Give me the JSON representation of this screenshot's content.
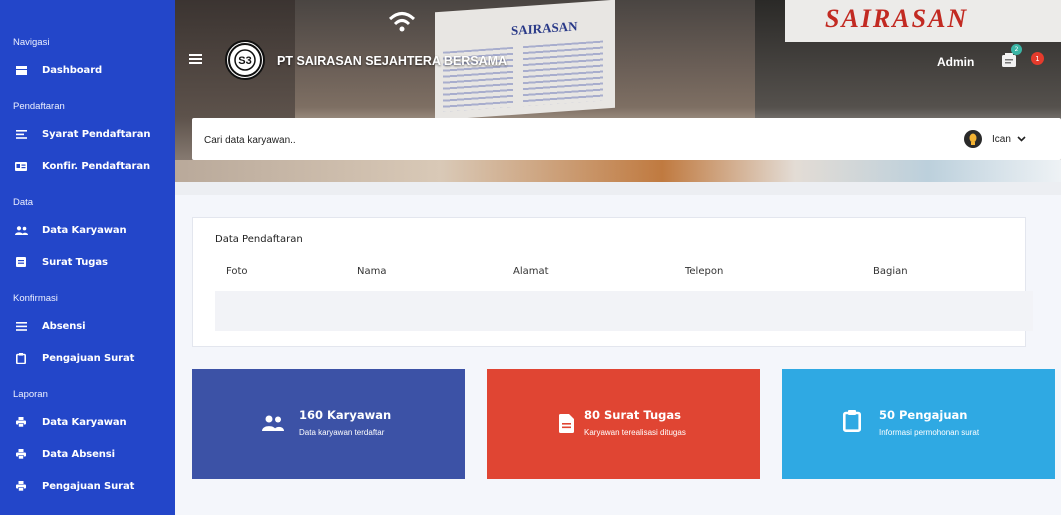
{
  "colors": {
    "sidebar": "#2346c9",
    "card_blue": "#3c52a6",
    "card_red": "#e04533",
    "card_cyan": "#2fa9e3",
    "badge_green": "#3bb6a6",
    "badge_red": "#e53b2c"
  },
  "sidebar": {
    "sections": [
      {
        "heading": "Navigasi",
        "items": [
          {
            "label": "Dashboard",
            "icon": "dashboard-icon"
          }
        ]
      },
      {
        "heading": "Pendaftaran",
        "items": [
          {
            "label": "Syarat Pendaftaran",
            "icon": "list-icon"
          },
          {
            "label": "Konfir. Pendaftaran",
            "icon": "id-card-icon"
          }
        ]
      },
      {
        "heading": "Data",
        "items": [
          {
            "label": "Data Karyawan",
            "icon": "users-icon"
          },
          {
            "label": "Surat Tugas",
            "icon": "document-icon"
          }
        ]
      },
      {
        "heading": "Konfirmasi",
        "items": [
          {
            "label": "Absensi",
            "icon": "list-icon"
          },
          {
            "label": "Pengajuan Surat",
            "icon": "clipboard-icon"
          }
        ]
      },
      {
        "heading": "Laporan",
        "items": [
          {
            "label": "Data Karyawan",
            "icon": "print-icon"
          },
          {
            "label": "Data Absensi",
            "icon": "print-icon"
          },
          {
            "label": "Pengajuan Surat",
            "icon": "print-icon"
          }
        ]
      }
    ]
  },
  "header": {
    "company": "PT SAIRASAN SEJAHTERA BERSAMA",
    "admin_label": "Admin",
    "notif_count": "2",
    "alert_count": "1",
    "banner_sign_text": "SAIRASAN"
  },
  "search": {
    "placeholder": "Cari data karyawan.."
  },
  "user": {
    "name": "Ican"
  },
  "data_card": {
    "title": "Data Pendaftaran",
    "columns": [
      "Foto",
      "Nama",
      "Alamat",
      "Telepon",
      "Bagian"
    ]
  },
  "stats": [
    {
      "title": "160 Karyawan",
      "subtitle": "Data karyawan terdaftar",
      "icon": "users-icon"
    },
    {
      "title": "80 Surat Tugas",
      "subtitle": "Karyawan terealisasi ditugas",
      "icon": "document-icon"
    },
    {
      "title": "50 Pengajuan",
      "subtitle": "Informasi permohonan surat",
      "icon": "clipboard-icon"
    }
  ]
}
